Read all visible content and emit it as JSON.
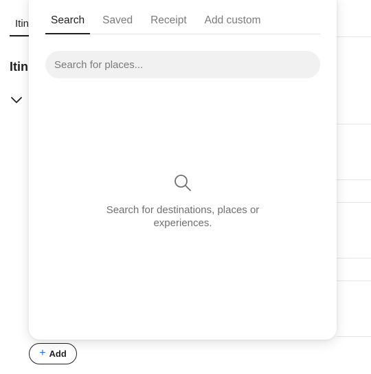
{
  "background": {
    "tab_label": "Itin",
    "heading": "Itin",
    "chevron_icon": "chevron-down-icon"
  },
  "add_button": {
    "icon": "plus-icon",
    "label": "Add",
    "icon_color": "#1a73e8"
  },
  "popover": {
    "tabs": [
      {
        "label": "Search",
        "active": true
      },
      {
        "label": "Saved",
        "active": false
      },
      {
        "label": "Receipt",
        "active": false
      },
      {
        "label": "Add custom",
        "active": false
      }
    ],
    "search": {
      "placeholder": "Search for places...",
      "value": ""
    },
    "empty_state": {
      "icon": "search-icon",
      "message": "Search for destinations, places or experiences."
    }
  }
}
